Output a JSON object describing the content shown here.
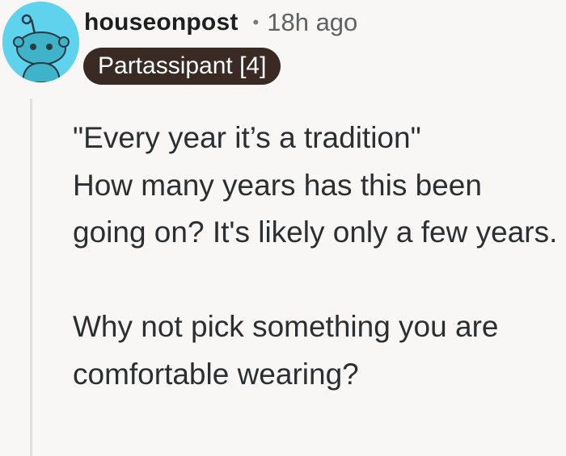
{
  "comment": {
    "username": "houseonpost",
    "separator": "•",
    "timestamp": "18h ago",
    "flair": "Partassipant [4]",
    "paragraphs": [
      "\"Every year it’s a tradition\"\nHow many years has this been going on? It's likely only a few years.",
      "Why not pick something you are comfortable wearing?"
    ]
  },
  "icons": {
    "avatar": "snoo-avatar-icon"
  },
  "colors": {
    "avatar_bg": "#5fd2ee",
    "flair_bg": "#3a2a24",
    "thread_line": "#e3e1df",
    "page_bg": "#f8f7f6"
  }
}
